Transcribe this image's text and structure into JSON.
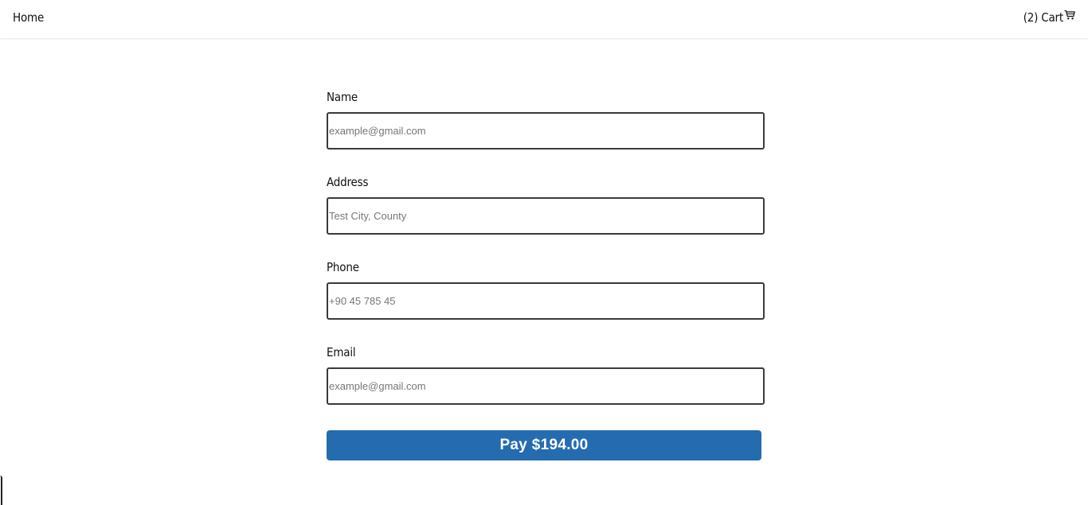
{
  "nav": {
    "home_label": "Home",
    "cart_count": "(2)",
    "cart_label": "Cart",
    "cart_icon": "cart-icon"
  },
  "form": {
    "fields": [
      {
        "label": "Name",
        "placeholder": "example@gmail.com",
        "value": ""
      },
      {
        "label": "Address",
        "placeholder": "Test City, County",
        "value": ""
      },
      {
        "label": "Phone",
        "placeholder": "+90 45 785 45",
        "value": ""
      },
      {
        "label": "Email",
        "placeholder": "example@gmail.com",
        "value": ""
      }
    ],
    "pay_label": "Pay $194.00"
  },
  "colors": {
    "accent": "#256bb0",
    "input_border": "#3a3a3a",
    "text": "#111111"
  }
}
